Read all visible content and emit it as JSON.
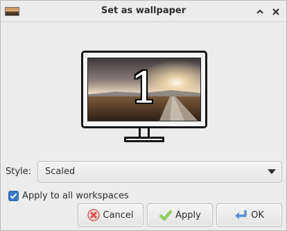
{
  "window": {
    "title": "Set as wallpaper",
    "icons": {
      "app": "wallpaper-thumbnail-icon",
      "rollup": "chevron-up-icon",
      "close": "close-icon"
    }
  },
  "preview": {
    "workspace_number": "1"
  },
  "style": {
    "label": "Style:",
    "selected": "Scaled"
  },
  "apply_all": {
    "label": "Apply to all workspaces",
    "checked": true
  },
  "buttons": {
    "cancel": "Cancel",
    "apply": "Apply",
    "ok": "OK"
  },
  "colors": {
    "checkbox": "#3a78c4",
    "cancel_icon": "#d9534f",
    "apply_icon": "#6cbf3a",
    "ok_icon": "#5b8fd1"
  }
}
